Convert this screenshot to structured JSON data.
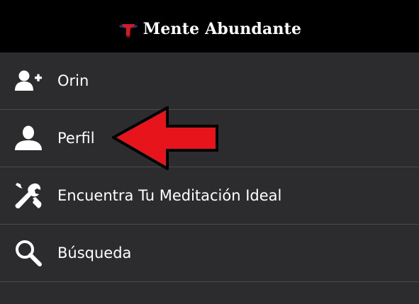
{
  "header": {
    "title": "Mente Abundante",
    "logo_icon": "bull-logo-icon",
    "background": "#000000"
  },
  "menu": {
    "items": [
      {
        "label": "Orin",
        "icon": "add-user-icon"
      },
      {
        "label": "Perfil",
        "icon": "user-profile-icon"
      },
      {
        "label": "Encuentra Tu Meditación Ideal",
        "icon": "tools-icon"
      },
      {
        "label": "Búsqueda",
        "icon": "search-icon"
      }
    ],
    "background": "#2c2c2e",
    "text_color": "#ffffff"
  },
  "annotation": {
    "arrow_color": "#e8141c",
    "points_to": "Perfil"
  }
}
